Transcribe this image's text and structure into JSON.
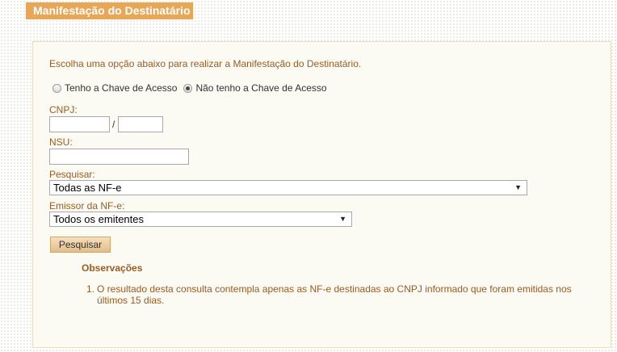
{
  "header": {
    "title": "Manifestação do Destinatário"
  },
  "form": {
    "instruction": "Escolha uma opção abaixo para realizar a Manifestação do Destinatário.",
    "radio_options": [
      {
        "label": "Tenho a Chave de Acesso",
        "checked": false
      },
      {
        "label": "Não tenho a Chave de Acesso",
        "checked": true
      }
    ],
    "cnpj_label": "CNPJ:",
    "cnpj_separator": "/",
    "cnpj_part1_value": "",
    "cnpj_part2_value": "",
    "nsu_label": "NSU:",
    "nsu_value": "",
    "pesquisar_label": "Pesquisar:",
    "pesquisar_selected": "Todas as NF-e",
    "emissor_label": "Emissor da NF-e:",
    "emissor_selected": "Todos os emitentes",
    "submit_label": "Pesquisar"
  },
  "observations": {
    "title": "Observações",
    "items": [
      {
        "number": "1.",
        "text": "O resultado desta consulta contempla apenas as NF-e destinadas ao CNPJ informado que foram emitidas nos últimos 15 dias."
      }
    ]
  },
  "icons": {
    "select_arrow": "dropdown-arrow-icon"
  }
}
